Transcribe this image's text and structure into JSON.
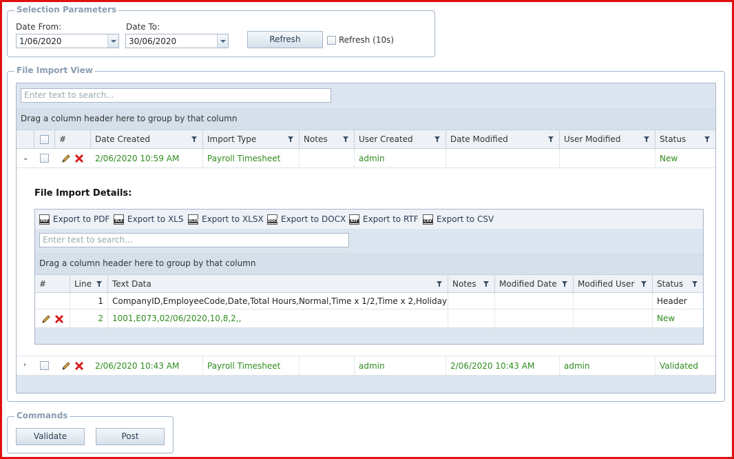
{
  "selection": {
    "legend": "Selection Parameters",
    "date_from_label": "Date From:",
    "date_from_value": "1/06/2020",
    "date_to_label": "Date To:",
    "date_to_value": "30/06/2020",
    "refresh_label": "Refresh",
    "auto_refresh_label": "Refresh (10s)"
  },
  "file_import_view": {
    "legend": "File Import View",
    "search_placeholder": "Enter text to search...",
    "group_hint": "Drag a column header here to group by that column",
    "columns": [
      "#",
      "Date Created",
      "Import Type",
      "Notes",
      "User Created",
      "Date Modified",
      "User Modified",
      "Status"
    ],
    "rows": [
      {
        "date_created": "2/06/2020 10:59 AM",
        "import_type": "Payroll Timesheet",
        "notes": "",
        "user_created": "admin",
        "date_modified": "",
        "user_modified": "",
        "status": "New"
      },
      {
        "date_created": "2/06/2020 10:43 AM",
        "import_type": "Payroll Timesheet",
        "notes": "",
        "user_created": "admin",
        "date_modified": "2/06/2020 10:43 AM",
        "user_modified": "admin",
        "status": "Validated"
      }
    ]
  },
  "details": {
    "title": "File Import Details:",
    "exports": [
      {
        "icon": "PDF",
        "label": "Export to PDF"
      },
      {
        "icon": "XLS",
        "label": "Export to XLS"
      },
      {
        "icon": "XLSX",
        "label": "Export to XLSX"
      },
      {
        "icon": "DOCX",
        "label": "Export to DOCX"
      },
      {
        "icon": "RTF",
        "label": "Export to RTF"
      },
      {
        "icon": "CSV",
        "label": "Export to CSV"
      }
    ],
    "search_placeholder": "Enter text to search...",
    "group_hint": "Drag a column header here to group by that column",
    "columns": [
      "#",
      "Line",
      "Text Data",
      "Notes",
      "Modified Date",
      "Modified User",
      "Status"
    ],
    "rows": [
      {
        "line": "1",
        "text_data": "CompanyID,EmployeeCode,Date,Total Hours,Normal,Time x 1/2,Time x 2,Holiday",
        "notes": "",
        "modified_date": "",
        "modified_user": "",
        "status": "Header"
      },
      {
        "line": "2",
        "text_data": "1001,E073,02/06/2020,10,8,2,,",
        "notes": "",
        "modified_date": "",
        "modified_user": "",
        "status": "New"
      }
    ]
  },
  "commands": {
    "legend": "Commands",
    "validate_label": "Validate",
    "post_label": "Post"
  },
  "colors": {
    "frame": "#e01010",
    "accent_text": "#2e8b1e",
    "legend": "#8a9db3"
  }
}
